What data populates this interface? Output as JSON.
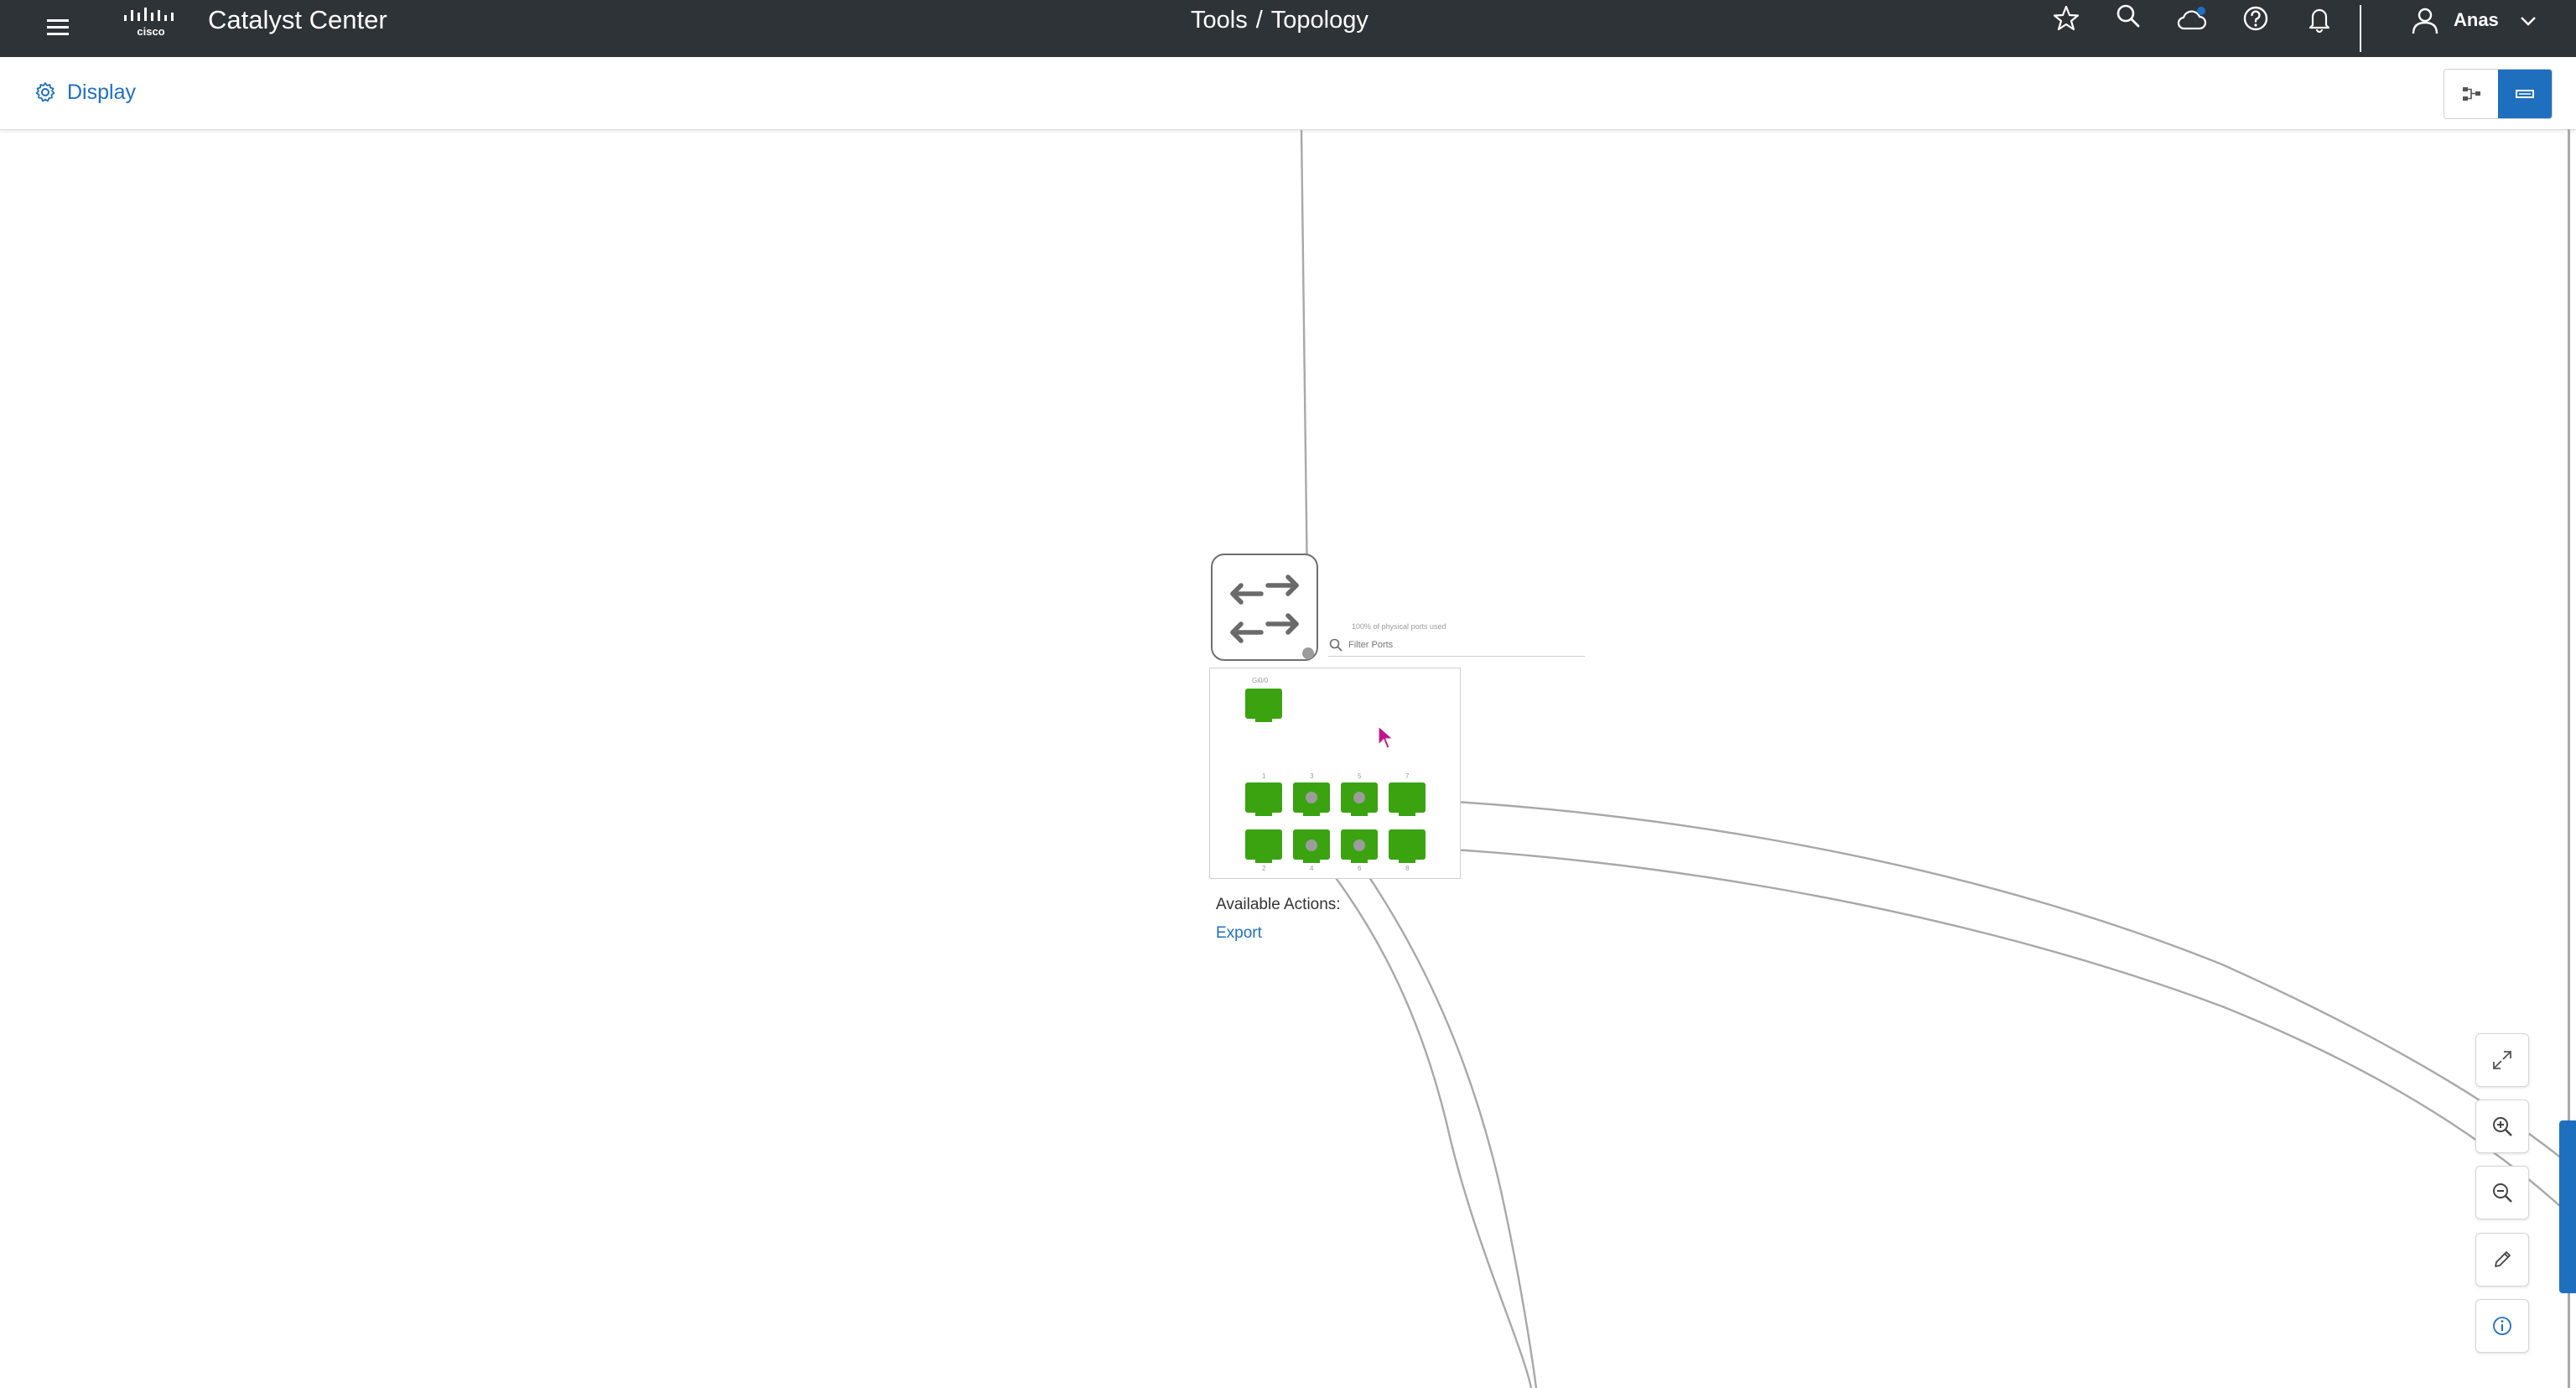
{
  "header": {
    "app_title": "Catalyst Center",
    "breadcrumb": [
      "Tools",
      "Topology"
    ],
    "breadcrumb_separator": "/",
    "icons": [
      "menu-icon",
      "star-icon",
      "search-icon",
      "cloud-icon",
      "help-icon",
      "bell-icon"
    ],
    "user": {
      "name": "Anas"
    },
    "colors": {
      "background": "#2e3338",
      "text": "#ffffff",
      "notification_dot": "#1f6fbf"
    }
  },
  "toolbar": {
    "display_label": "Display",
    "view_options": [
      "topology-view-icon",
      "list-view-icon"
    ],
    "active_view": "list-view-icon",
    "accent": "#1f6fbf"
  },
  "device_panel": {
    "ports_used": "100% of physical ports used",
    "filter_placeholder": "Filter Ports",
    "mgmt_port_label": "Gi0/0",
    "port_labels_top": [
      "1",
      "3",
      "5",
      "7"
    ],
    "port_labels_bottom": [
      "2",
      "4",
      "6",
      "8"
    ],
    "port_color": "#3aa30f",
    "actions_label": "Available Actions:",
    "export_label": "Export"
  },
  "zoom_controls": [
    "fit-to-screen-icon",
    "zoom-in-icon",
    "zoom-out-icon",
    "edit-icon",
    "info-icon"
  ]
}
